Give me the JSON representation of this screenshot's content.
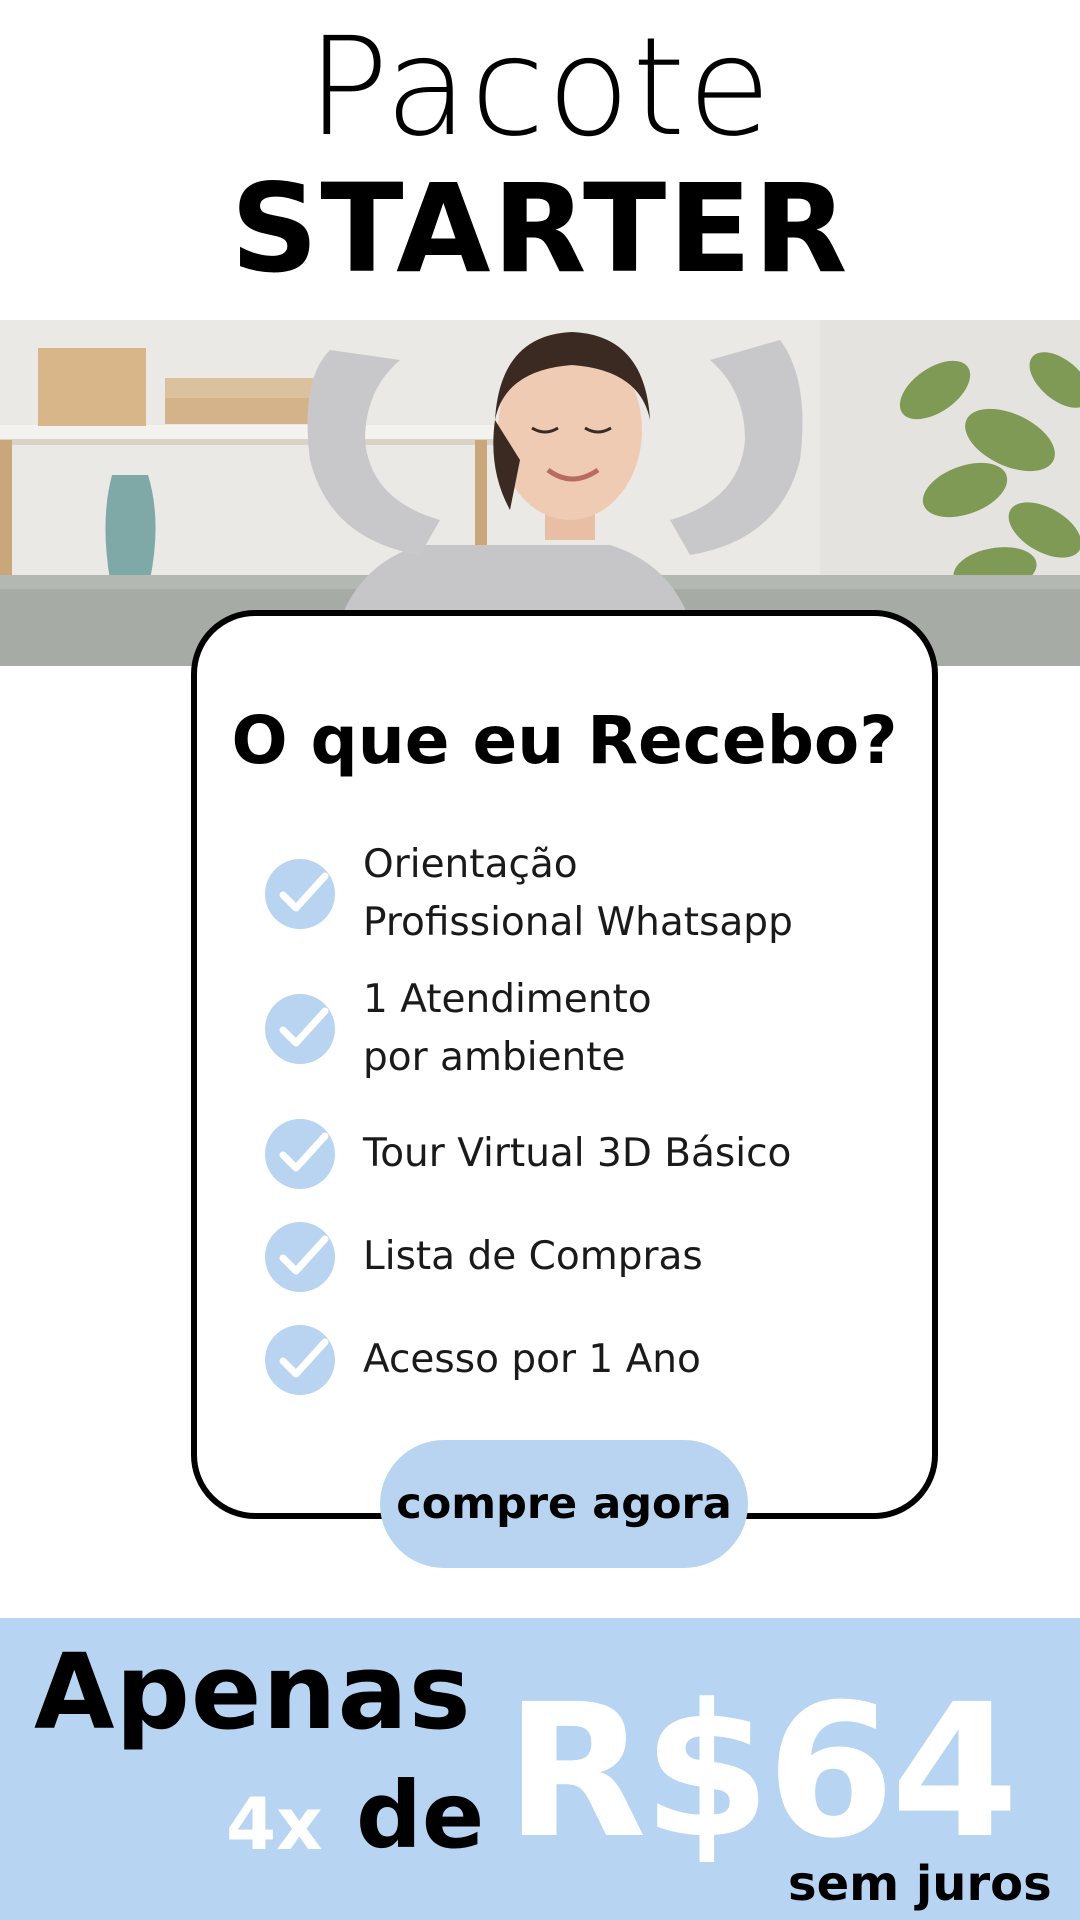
{
  "header": {
    "title_line1": "Pacote",
    "title_line2": "STARTER"
  },
  "card": {
    "heading": "O que eu Recebo?",
    "items": [
      {
        "label": "Orientação\nProfissional Whatsapp",
        "icon": "check-circle-icon"
      },
      {
        "label": " 1 Atendimento\npor ambiente",
        "icon": "check-circle-icon"
      },
      {
        "label": "Tour Virtual 3D Básico",
        "icon": "check-circle-icon"
      },
      {
        "label": "Lista de Compras",
        "icon": "check-circle-icon"
      },
      {
        "label": "Acesso por  1 Ano",
        "icon": "check-circle-icon"
      }
    ],
    "cta_label": "compre agora"
  },
  "price": {
    "prefix": "Apenas",
    "installments": "4x",
    "de": "de",
    "amount": "R$64",
    "suffix": "sem juros"
  },
  "colors": {
    "accent": "#b9d4f0",
    "price_band": "#b7d4f2",
    "text": "#000000",
    "price_text": "#ffffff"
  }
}
